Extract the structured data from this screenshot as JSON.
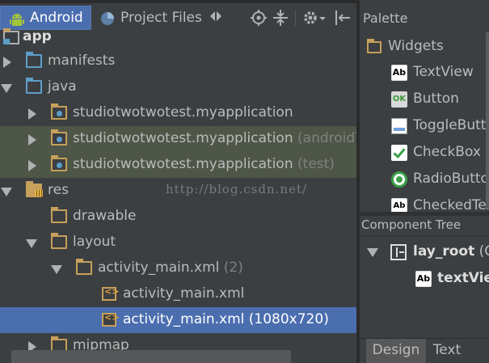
{
  "toolbar": {
    "tabs": [
      {
        "label": "Android",
        "active": true
      },
      {
        "label": "Project Files",
        "active": false
      }
    ],
    "icons": [
      "android-icon",
      "project-files-icon",
      "switch-arrows-icon",
      "locate-target-icon",
      "collapse-all-icon",
      "gear-dropdown-icon",
      "hide-pane-icon"
    ]
  },
  "tree": {
    "rows": [
      {
        "label": "app",
        "hint": "",
        "depth": 0,
        "arrow": "none",
        "icon": "module-folder-icon"
      },
      {
        "label": "manifests",
        "hint": "",
        "depth": 1,
        "arrow": "right",
        "icon": "folder-icon"
      },
      {
        "label": "java",
        "hint": "",
        "depth": 1,
        "arrow": "down",
        "icon": "folder-icon"
      },
      {
        "label": "studiotwotwotest.myapplication",
        "hint": "",
        "depth": 2,
        "arrow": "right",
        "icon": "package-icon"
      },
      {
        "label": "studiotwotwotest.myapplication",
        "hint": "(androidTest)",
        "depth": 2,
        "arrow": "right",
        "icon": "package-icon"
      },
      {
        "label": "studiotwotwotest.myapplication",
        "hint": "(test)",
        "depth": 2,
        "arrow": "right",
        "icon": "package-icon"
      },
      {
        "label": "res",
        "hint": "",
        "depth": 1,
        "arrow": "down",
        "icon": "res-folder-icon"
      },
      {
        "label": "drawable",
        "hint": "",
        "depth": 2,
        "arrow": "none",
        "icon": "folder-icon"
      },
      {
        "label": "layout",
        "hint": "",
        "depth": 2,
        "arrow": "down",
        "icon": "folder-icon"
      },
      {
        "label": "activity_main.xml",
        "hint": "(2)",
        "depth": 3,
        "arrow": "down",
        "icon": "folder-icon"
      },
      {
        "label": "activity_main.xml",
        "hint": "",
        "depth": 4,
        "arrow": "none",
        "icon": "xml-file-icon"
      },
      {
        "label": "activity_main.xml (1080x720)",
        "hint": "",
        "depth": 4,
        "arrow": "none",
        "icon": "xml-file-icon"
      },
      {
        "label": "mipmap",
        "hint": "",
        "depth": 2,
        "arrow": "right",
        "icon": "folder-icon"
      }
    ],
    "watermark": "http://blog.csdn.net/"
  },
  "palette": {
    "title": "Palette",
    "group": "Widgets",
    "items": [
      {
        "label": "TextView",
        "icon": "textview-icon"
      },
      {
        "label": "Button",
        "icon": "button-icon"
      },
      {
        "label": "ToggleButton",
        "icon": "togglebutton-icon"
      },
      {
        "label": "CheckBox",
        "icon": "checkbox-icon"
      },
      {
        "label": "RadioButton",
        "icon": "radiobutton-icon"
      },
      {
        "label": "CheckedTextView",
        "icon": "checkedtextview-icon"
      }
    ]
  },
  "component_tree": {
    "title": "Component Tree",
    "root": {
      "label": "lay_root",
      "hint": "(C"
    },
    "child": {
      "label": "textView"
    }
  },
  "bottom_tabs": {
    "design": "Design",
    "text": "Text"
  },
  "colors": {
    "background": "#3c3f41",
    "selection": "#4b6eaf",
    "highlight_row": "#4e5648",
    "folder": "#c7a05a",
    "source_folder": "#5d9ec9"
  }
}
